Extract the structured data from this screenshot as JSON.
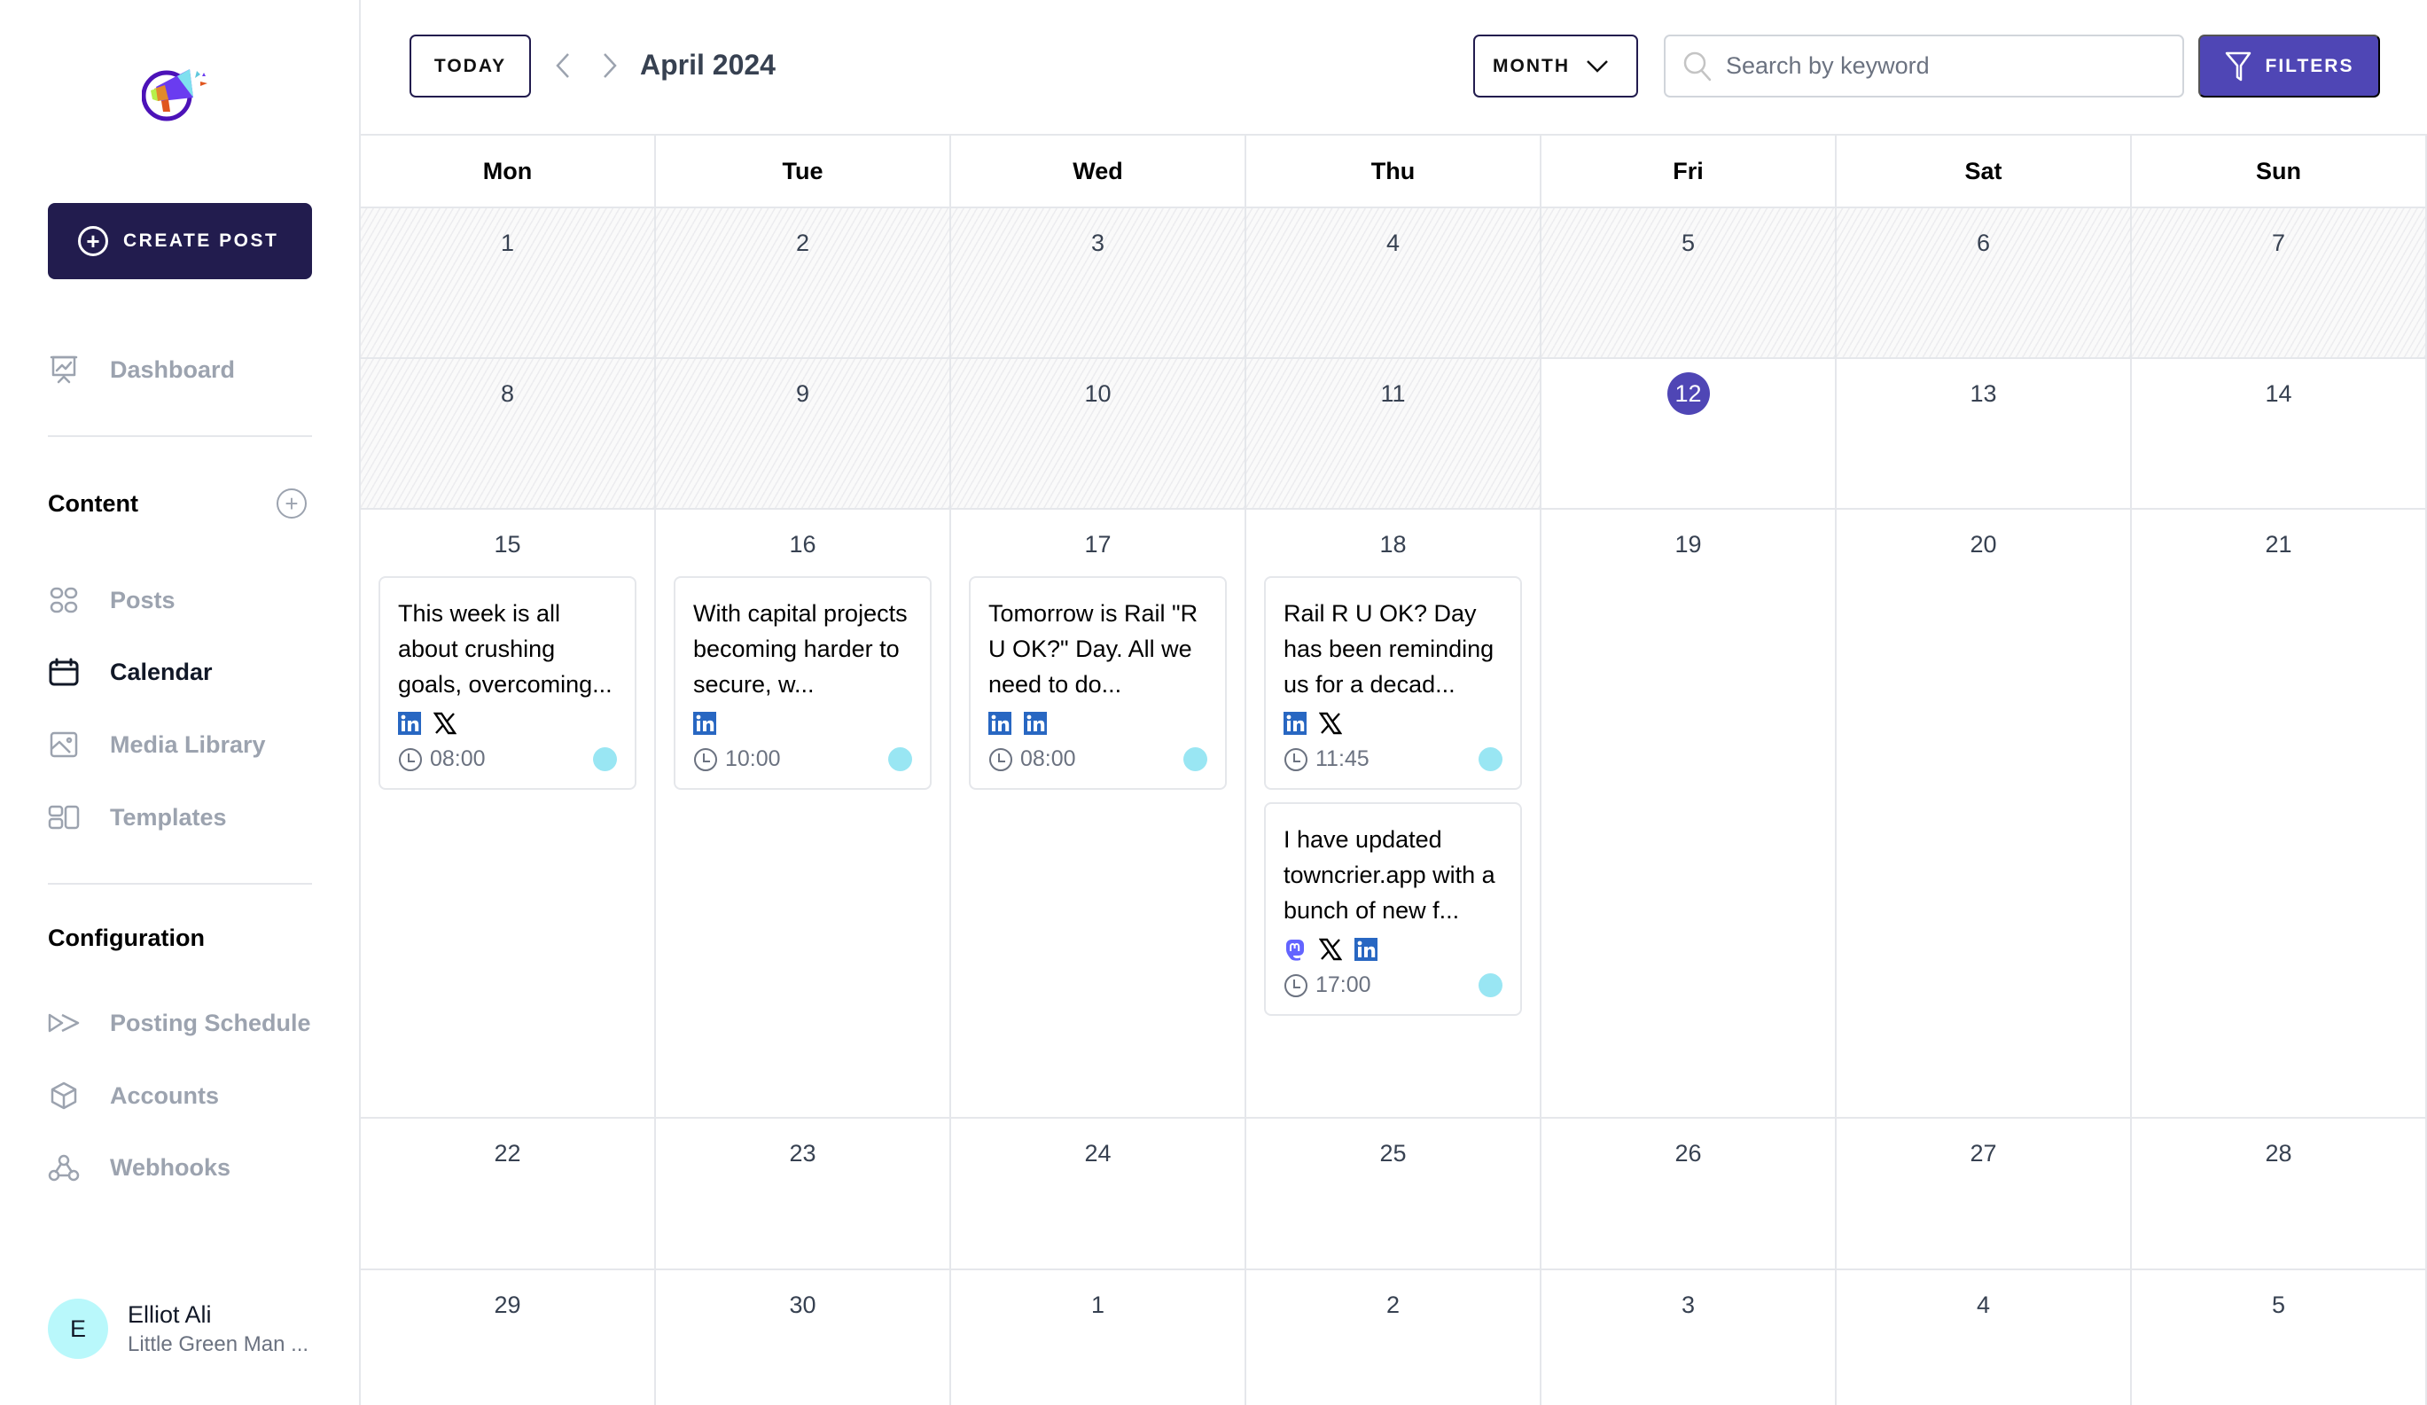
{
  "sidebar": {
    "create_post_label": "CREATE POST",
    "dashboard_label": "Dashboard",
    "content_heading": "Content",
    "content_items": [
      {
        "label": "Posts",
        "icon": "grid-icon",
        "active": false
      },
      {
        "label": "Calendar",
        "icon": "calendar-icon",
        "active": true
      },
      {
        "label": "Media Library",
        "icon": "image-icon",
        "active": false
      },
      {
        "label": "Templates",
        "icon": "templates-icon",
        "active": false
      }
    ],
    "configuration_heading": "Configuration",
    "configuration_items": [
      {
        "label": "Posting Schedule",
        "icon": "fast-forward-icon"
      },
      {
        "label": "Accounts",
        "icon": "cube-icon"
      },
      {
        "label": "Webhooks",
        "icon": "webhook-icon"
      }
    ],
    "user": {
      "initial": "E",
      "name": "Elliot Ali",
      "org": "Little Green Man ..."
    }
  },
  "header": {
    "today_label": "TODAY",
    "title": "April 2024",
    "view_label": "MONTH",
    "search_placeholder": "Search by keyword",
    "search_value": "",
    "filters_label": "FILTERS"
  },
  "colors": {
    "primary": "#4f46b5",
    "navy": "#221c4e",
    "status_dot": "#99e6f3",
    "linkedin": "#2867c2",
    "mastodon": "#6364ff"
  },
  "calendar": {
    "weekdays": [
      "Mon",
      "Tue",
      "Wed",
      "Thu",
      "Fri",
      "Sat",
      "Sun"
    ],
    "today": 12,
    "weeks": [
      {
        "days": [
          {
            "num": "1",
            "past": true
          },
          {
            "num": "2",
            "past": true
          },
          {
            "num": "3",
            "past": true
          },
          {
            "num": "4",
            "past": true
          },
          {
            "num": "5",
            "past": true
          },
          {
            "num": "6",
            "past": true
          },
          {
            "num": "7",
            "past": true
          }
        ]
      },
      {
        "days": [
          {
            "num": "8",
            "past": true
          },
          {
            "num": "9",
            "past": true
          },
          {
            "num": "10",
            "past": true
          },
          {
            "num": "11",
            "past": true
          },
          {
            "num": "12",
            "today": true
          },
          {
            "num": "13"
          },
          {
            "num": "14"
          }
        ]
      },
      {
        "days": [
          {
            "num": "15",
            "posts": [
              {
                "text": "This week is all about crushing goals, overcoming...",
                "networks": [
                  "linkedin",
                  "x"
                ],
                "time": "08:00"
              }
            ]
          },
          {
            "num": "16",
            "posts": [
              {
                "text": "With capital projects becoming harder to secure, w...",
                "networks": [
                  "linkedin"
                ],
                "time": "10:00"
              }
            ]
          },
          {
            "num": "17",
            "posts": [
              {
                "text": "Tomorrow is Rail \"R U OK?\" Day. All we need to do...",
                "networks": [
                  "linkedin",
                  "linkedin"
                ],
                "time": "08:00"
              }
            ]
          },
          {
            "num": "18",
            "posts": [
              {
                "text": "Rail R U OK? Day has been reminding us for a decad...",
                "networks": [
                  "linkedin",
                  "x"
                ],
                "time": "11:45"
              },
              {
                "text": "I have updated towncrier.app with a bunch of new f...",
                "networks": [
                  "mastodon",
                  "x",
                  "linkedin"
                ],
                "time": "17:00"
              }
            ]
          },
          {
            "num": "19"
          },
          {
            "num": "20"
          },
          {
            "num": "21"
          }
        ]
      },
      {
        "days": [
          {
            "num": "22"
          },
          {
            "num": "23"
          },
          {
            "num": "24"
          },
          {
            "num": "25"
          },
          {
            "num": "26"
          },
          {
            "num": "27"
          },
          {
            "num": "28"
          }
        ]
      },
      {
        "days": [
          {
            "num": "29"
          },
          {
            "num": "30"
          },
          {
            "num": "1"
          },
          {
            "num": "2"
          },
          {
            "num": "3"
          },
          {
            "num": "4"
          },
          {
            "num": "5"
          }
        ]
      }
    ]
  }
}
